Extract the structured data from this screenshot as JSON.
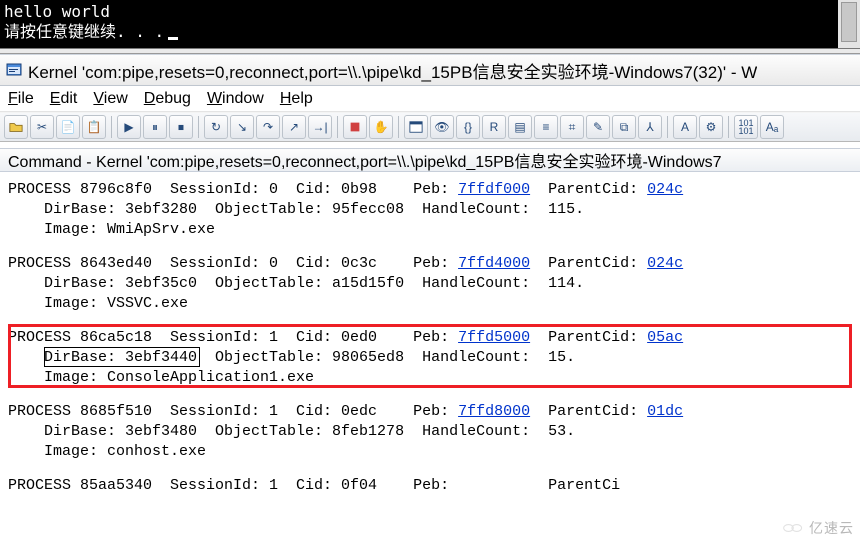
{
  "console": {
    "line1": "hello world",
    "line2": "请按任意键继续. . ."
  },
  "titlebar": {
    "title": "Kernel 'com:pipe,resets=0,reconnect,port=\\\\.\\pipe\\kd_15PB信息安全实验环境-Windows7(32)' - W"
  },
  "menubar": {
    "items": [
      {
        "label": "File",
        "key": "F"
      },
      {
        "label": "Edit",
        "key": "E"
      },
      {
        "label": "View",
        "key": "V"
      },
      {
        "label": "Debug",
        "key": "D"
      },
      {
        "label": "Window",
        "key": "W"
      },
      {
        "label": "Help",
        "key": "H"
      }
    ]
  },
  "toolbar": {
    "buttons": [
      "open",
      "cut",
      "copy",
      "paste",
      "sep",
      "go",
      "break",
      "stop",
      "sep",
      "restart",
      "step-into",
      "step-over",
      "step-out",
      "run-to",
      "sep",
      "toggle-bp",
      "breakpoints",
      "sep",
      "cmd-window",
      "watch",
      "locals",
      "registers",
      "memory",
      "call-stack",
      "disasm",
      "scratch",
      "processes",
      "threads",
      "sep",
      "font",
      "options",
      "sep",
      "src-mode",
      "asm-mode"
    ]
  },
  "cmd_header": {
    "title": "Command - Kernel 'com:pipe,resets=0,reconnect,port=\\\\.\\pipe\\kd_15PB信息安全实验环境-Windows7"
  },
  "processes": [
    {
      "addr": "8796c8f0",
      "session": "0",
      "cid": "0b98",
      "peb": "7ffdf000",
      "parent": "024c",
      "dirbase": "3ebf3280",
      "objtab": "95fecc08",
      "handles": "115",
      "image": "WmiApSrv.exe",
      "highlight": false
    },
    {
      "addr": "8643ed40",
      "session": "0",
      "cid": "0c3c",
      "peb": "7ffd4000",
      "parent": "024c",
      "dirbase": "3ebf35c0",
      "objtab": "a15d15f0",
      "handles": "114",
      "image": "VSSVC.exe",
      "highlight": false
    },
    {
      "addr": "86ca5c18",
      "session": "1",
      "cid": "0ed0",
      "peb": "7ffd5000",
      "parent": "05ac",
      "dirbase": "3ebf3440",
      "objtab": "98065ed8",
      "handles": "15",
      "image": "ConsoleApplication1.exe",
      "highlight": true
    },
    {
      "addr": "8685f510",
      "session": "1",
      "cid": "0edc",
      "peb": "7ffd8000",
      "parent": "01dc",
      "dirbase": "3ebf3480",
      "objtab": "8feb1278",
      "handles": "53",
      "image": "conhost.exe",
      "highlight": false
    }
  ],
  "partial_line": "PROCESS 85aa5340  SessionId: 1  Cid: 0f04    Peb:           ParentCi",
  "labels": {
    "process": "PROCESS",
    "session": "SessionId:",
    "cid": "Cid:",
    "peb": "Peb:",
    "parent": "ParentCid:",
    "dirbase": "DirBase:",
    "objtab": "ObjectTable:",
    "handles": "HandleCount:",
    "image": "Image:"
  },
  "watermark": "亿速云"
}
